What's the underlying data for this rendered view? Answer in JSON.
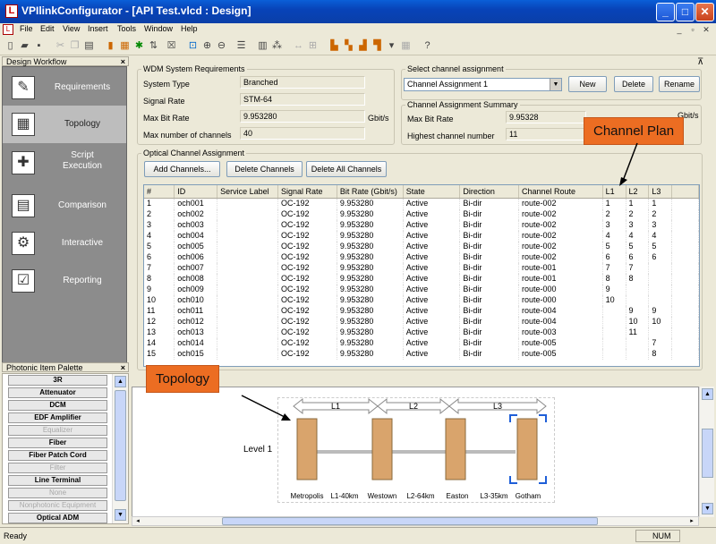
{
  "window": {
    "title": "VPIlinkConfigurator - [API Test.vlcd : Design]",
    "app_icon": "L"
  },
  "menu": [
    "File",
    "Edit",
    "View",
    "Insert",
    "Tools",
    "Window",
    "Help"
  ],
  "workflow": {
    "title": "Design Workflow",
    "items": [
      {
        "label": "Requirements",
        "icon": "✎"
      },
      {
        "label": "Topology",
        "icon": "▦",
        "selected": true
      },
      {
        "label": "Script Execution",
        "icon": "✚"
      },
      {
        "label": "Comparison",
        "icon": "▤"
      },
      {
        "label": "Interactive",
        "icon": "⚙"
      },
      {
        "label": "Reporting",
        "icon": "☑"
      }
    ]
  },
  "palette": {
    "title": "Photonic Item Palette",
    "items": [
      {
        "label": "3R",
        "enabled": true
      },
      {
        "label": "Attenuator",
        "enabled": true
      },
      {
        "label": "DCM",
        "enabled": true
      },
      {
        "label": "EDF Amplifier",
        "enabled": true
      },
      {
        "label": "Equalizer",
        "enabled": false
      },
      {
        "label": "Fiber",
        "enabled": true
      },
      {
        "label": "Fiber Patch Cord",
        "enabled": true
      },
      {
        "label": "Filter",
        "enabled": false
      },
      {
        "label": "Line Terminal",
        "enabled": true
      },
      {
        "label": "None",
        "enabled": false
      },
      {
        "label": "Nonphotonic Equipment",
        "enabled": false
      },
      {
        "label": "Optical ADM",
        "enabled": true
      }
    ]
  },
  "requirements": {
    "legend": "WDM System Requirements",
    "system_type_label": "System Type",
    "system_type": "Branched",
    "signal_rate_label": "Signal Rate",
    "signal_rate": "STM-64",
    "max_bit_rate_label": "Max Bit Rate",
    "max_bit_rate": "9.953280",
    "unit": "Gbit/s",
    "max_channels_label": "Max number of channels",
    "max_channels": "40"
  },
  "assignment": {
    "legend": "Select channel assignment",
    "selected": "Channel Assignment 1",
    "new": "New",
    "delete": "Delete",
    "rename": "Rename"
  },
  "summary": {
    "legend": "Channel Assignment Summary",
    "max_bit_rate_label": "Max Bit Rate",
    "max_bit_rate": "9.95328",
    "unit": "Gbit/s",
    "highest_label": "Highest channel number",
    "highest": "11"
  },
  "oca": {
    "legend": "Optical Channel Assignment",
    "add": "Add Channels...",
    "delete": "Delete Channels",
    "delete_all": "Delete All Channels"
  },
  "table": {
    "columns": [
      "#",
      "ID",
      "Service Label",
      "Signal Rate",
      "Bit Rate (Gbit/s)",
      "State",
      "Direction",
      "Channel Route",
      "L1",
      "L2",
      "L3"
    ],
    "rows": [
      [
        "1",
        "och001",
        "",
        "OC-192",
        "9.953280",
        "Active",
        "Bi-dir",
        "route-002",
        "1",
        "1",
        "1"
      ],
      [
        "2",
        "och002",
        "",
        "OC-192",
        "9.953280",
        "Active",
        "Bi-dir",
        "route-002",
        "2",
        "2",
        "2"
      ],
      [
        "3",
        "och003",
        "",
        "OC-192",
        "9.953280",
        "Active",
        "Bi-dir",
        "route-002",
        "3",
        "3",
        "3"
      ],
      [
        "4",
        "och004",
        "",
        "OC-192",
        "9.953280",
        "Active",
        "Bi-dir",
        "route-002",
        "4",
        "4",
        "4"
      ],
      [
        "5",
        "och005",
        "",
        "OC-192",
        "9.953280",
        "Active",
        "Bi-dir",
        "route-002",
        "5",
        "5",
        "5"
      ],
      [
        "6",
        "och006",
        "",
        "OC-192",
        "9.953280",
        "Active",
        "Bi-dir",
        "route-002",
        "6",
        "6",
        "6"
      ],
      [
        "7",
        "och007",
        "",
        "OC-192",
        "9.953280",
        "Active",
        "Bi-dir",
        "route-001",
        "7",
        "7",
        ""
      ],
      [
        "8",
        "och008",
        "",
        "OC-192",
        "9.953280",
        "Active",
        "Bi-dir",
        "route-001",
        "8",
        "8",
        ""
      ],
      [
        "9",
        "och009",
        "",
        "OC-192",
        "9.953280",
        "Active",
        "Bi-dir",
        "route-000",
        "9",
        "",
        ""
      ],
      [
        "10",
        "och010",
        "",
        "OC-192",
        "9.953280",
        "Active",
        "Bi-dir",
        "route-000",
        "10",
        "",
        ""
      ],
      [
        "11",
        "och011",
        "",
        "OC-192",
        "9.953280",
        "Active",
        "Bi-dir",
        "route-004",
        "",
        "9",
        "9"
      ],
      [
        "12",
        "och012",
        "",
        "OC-192",
        "9.953280",
        "Active",
        "Bi-dir",
        "route-004",
        "",
        "10",
        "10"
      ],
      [
        "13",
        "och013",
        "",
        "OC-192",
        "9.953280",
        "Active",
        "Bi-dir",
        "route-003",
        "",
        "11",
        ""
      ],
      [
        "14",
        "och014",
        "",
        "OC-192",
        "9.953280",
        "Active",
        "Bi-dir",
        "route-005",
        "",
        "",
        "7"
      ],
      [
        "15",
        "och015",
        "",
        "OC-192",
        "9.953280",
        "Active",
        "Bi-dir",
        "route-005",
        "",
        "",
        "8"
      ]
    ]
  },
  "callouts": {
    "channel_plan": "Channel Plan",
    "topology": "Topology"
  },
  "diagram": {
    "level": "Level 1",
    "links": [
      "L1",
      "L2",
      "L3"
    ],
    "nodes": [
      "Metropolis",
      "Westown",
      "Easton",
      "Gotham"
    ],
    "spans": [
      "L1-40km",
      "L2-64km",
      "L3-35km"
    ]
  },
  "status": {
    "text": "Ready",
    "num": "NUM"
  },
  "colors": {
    "callout": "#ec6d22",
    "titlebar": "#0a5fd8"
  }
}
